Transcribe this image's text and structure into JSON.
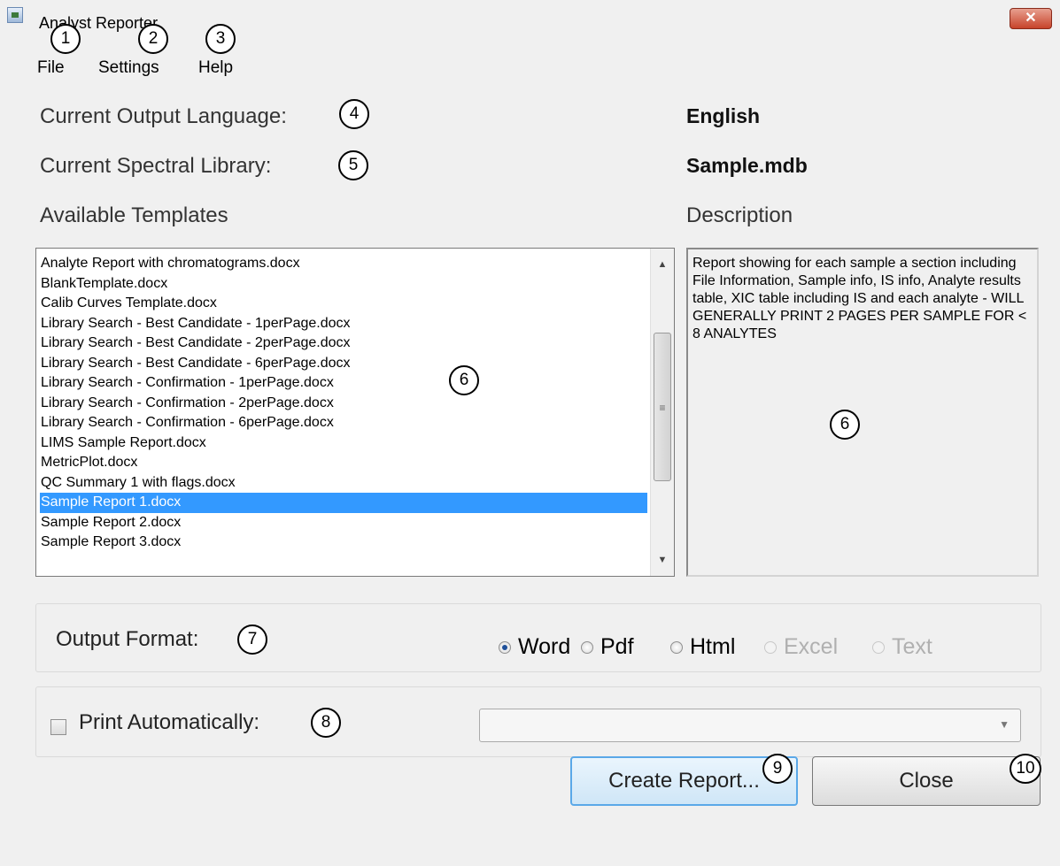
{
  "window": {
    "title": "Analyst Reporter",
    "close_label": "✕"
  },
  "menu": {
    "items": [
      "File",
      "Settings",
      "Help"
    ]
  },
  "info": {
    "language_label": "Current Output Language:",
    "language_value": "English",
    "library_label": "Current Spectral Library:",
    "library_value": "Sample.mdb",
    "templates_label": "Available Templates",
    "description_label": "Description"
  },
  "templates": {
    "items": [
      "Analyte Report with chromatograms.docx",
      "BlankTemplate.docx",
      "Calib Curves Template.docx",
      "Library Search - Best Candidate - 1perPage.docx",
      "Library Search - Best Candidate - 2perPage.docx",
      "Library Search - Best Candidate - 6perPage.docx",
      "Library Search - Confirmation - 1perPage.docx",
      "Library Search - Confirmation - 2perPage.docx",
      "Library Search - Confirmation - 6perPage.docx",
      "LIMS Sample Report.docx",
      "MetricPlot.docx",
      "QC Summary 1 with flags.docx",
      "Sample Report 1.docx",
      "Sample Report 2.docx",
      "Sample Report 3.docx"
    ],
    "selected_index": 12
  },
  "description": {
    "text": "Report showing for each sample a section including File Information, Sample info, IS info, Analyte results table, XIC table including IS and each analyte - WILL GENERALLY PRINT 2 PAGES PER SAMPLE FOR < 8 ANALYTES"
  },
  "output_format": {
    "label": "Output Format:",
    "options": [
      {
        "label": "Word",
        "checked": true,
        "enabled": true
      },
      {
        "label": "Pdf",
        "checked": false,
        "enabled": true
      },
      {
        "label": "Html",
        "checked": false,
        "enabled": true
      },
      {
        "label": "Excel",
        "checked": false,
        "enabled": false
      },
      {
        "label": "Text",
        "checked": false,
        "enabled": false
      }
    ]
  },
  "print": {
    "label": "Print Automatically:",
    "checked": false,
    "printer_value": ""
  },
  "buttons": {
    "create_label": "Create Report...",
    "close_label": "Close"
  },
  "callouts": [
    "1",
    "2",
    "3",
    "4",
    "5",
    "6",
    "6",
    "7",
    "8",
    "9",
    "10"
  ],
  "icons": {
    "app": "app-icon",
    "close": "close-icon",
    "scroll_up": "scroll-up-icon",
    "scroll_down": "scroll-down-icon",
    "dropdown": "chevron-down-icon"
  }
}
